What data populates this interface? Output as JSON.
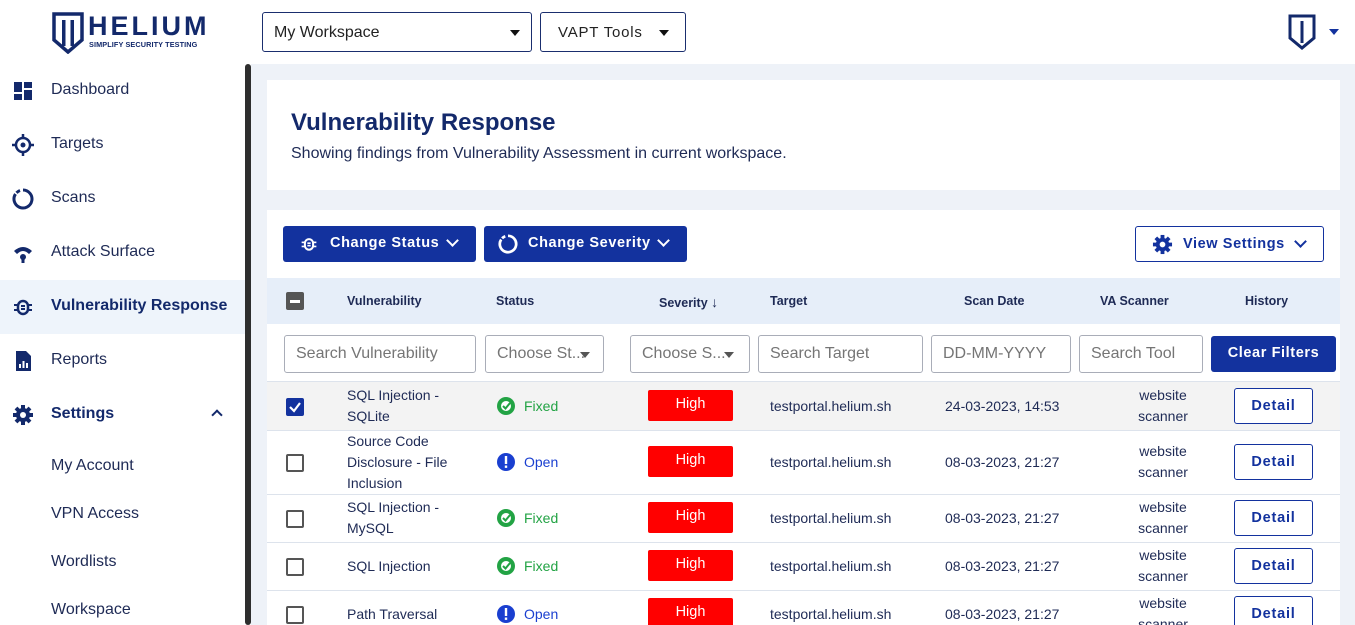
{
  "brand": {
    "name": "HELIUM",
    "tagline": "SIMPLIFY SECURITY TESTING"
  },
  "topbar": {
    "workspace_value": "My Workspace",
    "tools_value": "VAPT Tools"
  },
  "sidebar": {
    "items": [
      {
        "label": "Dashboard",
        "icon": "dashboard-icon"
      },
      {
        "label": "Targets",
        "icon": "target-icon"
      },
      {
        "label": "Scans",
        "icon": "scan-icon"
      },
      {
        "label": "Attack Surface",
        "icon": "attack-surface-icon"
      },
      {
        "label": "Vulnerability Response",
        "icon": "bug-icon"
      },
      {
        "label": "Reports",
        "icon": "report-icon"
      },
      {
        "label": "Settings",
        "icon": "gear-icon"
      }
    ],
    "settings_sub": [
      "My Account",
      "VPN Access",
      "Wordlists",
      "Workspace"
    ]
  },
  "header": {
    "title": "Vulnerability Response",
    "subtitle": "Showing findings from Vulnerability Assessment in current workspace."
  },
  "toolbar": {
    "change_status": "Change Status",
    "change_severity": "Change Severity",
    "view_settings": "View Settings"
  },
  "table": {
    "columns": [
      "Vulnerability",
      "Status",
      "Severity",
      "Target",
      "Scan Date",
      "VA Scanner",
      "History"
    ],
    "sort_indicator": "↓",
    "filters": {
      "vulnerability": "Search Vulnerability",
      "status": "Choose St...",
      "severity": "Choose S...",
      "target": "Search Target",
      "date": "DD-MM-YYYY",
      "tool": "Search Tool",
      "clear": "Clear Filters"
    },
    "rows": [
      {
        "checked": true,
        "vuln": [
          "SQL Injection -",
          "SQLite"
        ],
        "status": "Fixed",
        "severity": "High",
        "target": "testportal.helium.sh",
        "date": "24-03-2023, 14:53",
        "scanner": [
          "website",
          "scanner"
        ],
        "history": "Detail"
      },
      {
        "checked": false,
        "vuln": [
          "Source Code",
          "Disclosure - File",
          "Inclusion"
        ],
        "status": "Open",
        "severity": "High",
        "target": "testportal.helium.sh",
        "date": "08-03-2023, 21:27",
        "scanner": [
          "website",
          "scanner"
        ],
        "history": "Detail"
      },
      {
        "checked": false,
        "vuln": [
          "SQL Injection -",
          "MySQL"
        ],
        "status": "Fixed",
        "severity": "High",
        "target": "testportal.helium.sh",
        "date": "08-03-2023, 21:27",
        "scanner": [
          "website",
          "scanner"
        ],
        "history": "Detail"
      },
      {
        "checked": false,
        "vuln": [
          "SQL Injection"
        ],
        "status": "Fixed",
        "severity": "High",
        "target": "testportal.helium.sh",
        "date": "08-03-2023, 21:27",
        "scanner": [
          "website",
          "scanner"
        ],
        "history": "Detail"
      },
      {
        "checked": false,
        "vuln": [
          "Path Traversal"
        ],
        "status": "Open",
        "severity": "High",
        "target": "testportal.helium.sh",
        "date": "08-03-2023, 21:27",
        "scanner": [
          "website",
          "scanner"
        ],
        "history": "Detail"
      }
    ]
  },
  "colors": {
    "brand": "#13296b",
    "primary": "#13329e",
    "fixed": "#22a344",
    "open": "#1a3fd0",
    "high": "#ff0000"
  }
}
